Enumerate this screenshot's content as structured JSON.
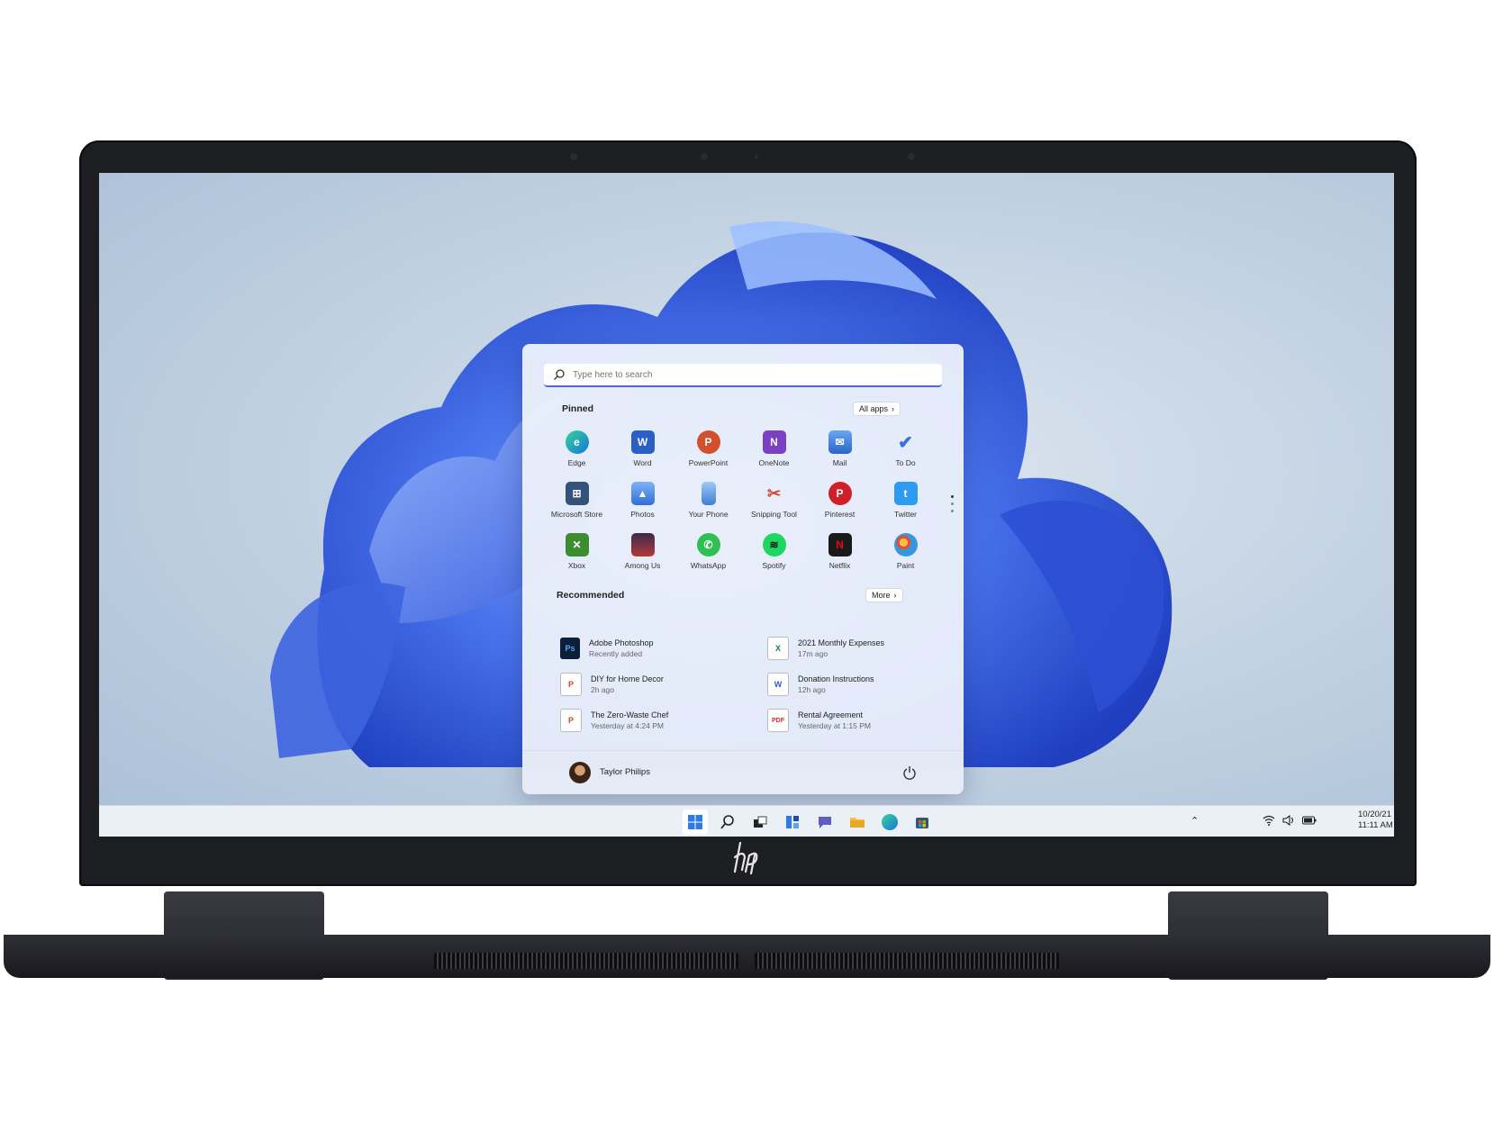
{
  "search": {
    "placeholder": "Type here to search"
  },
  "pinned": {
    "title": "Pinned",
    "all_apps": "All apps",
    "apps": [
      {
        "label": "Edge",
        "icon": "edge-icon"
      },
      {
        "label": "Word",
        "icon": "word-icon"
      },
      {
        "label": "PowerPoint",
        "icon": "powerpoint-icon"
      },
      {
        "label": "OneNote",
        "icon": "onenote-icon"
      },
      {
        "label": "Mail",
        "icon": "mail-icon"
      },
      {
        "label": "To Do",
        "icon": "todo-icon"
      },
      {
        "label": "Microsoft Store",
        "icon": "store-icon"
      },
      {
        "label": "Photos",
        "icon": "photos-icon"
      },
      {
        "label": "Your Phone",
        "icon": "phone-icon"
      },
      {
        "label": "Snipping Tool",
        "icon": "snipping-tool-icon"
      },
      {
        "label": "Pinterest",
        "icon": "pinterest-icon"
      },
      {
        "label": "Twitter",
        "icon": "twitter-icon"
      },
      {
        "label": "Xbox",
        "icon": "xbox-icon"
      },
      {
        "label": "Among Us",
        "icon": "among-us-icon"
      },
      {
        "label": "WhatsApp",
        "icon": "whatsapp-icon"
      },
      {
        "label": "Spotify",
        "icon": "spotify-icon"
      },
      {
        "label": "Netflix",
        "icon": "netflix-icon"
      },
      {
        "label": "Paint",
        "icon": "paint-icon"
      }
    ]
  },
  "recommended": {
    "title": "Recommended",
    "more": "More",
    "items": [
      {
        "name": "Adobe Photoshop",
        "sub": "Recently added",
        "icon": "photoshop-icon"
      },
      {
        "name": "2021 Monthly Expenses",
        "sub": "17m ago",
        "icon": "excel-file-icon"
      },
      {
        "name": "DIY for Home Decor",
        "sub": "2h ago",
        "icon": "powerpoint-file-icon"
      },
      {
        "name": "Donation Instructions",
        "sub": "12h ago",
        "icon": "word-file-icon"
      },
      {
        "name": "The Zero-Waste Chef",
        "sub": "Yesterday at 4:24 PM",
        "icon": "powerpoint-file-icon"
      },
      {
        "name": "Rental Agreement",
        "sub": "Yesterday at 1:15 PM",
        "icon": "pdf-file-icon"
      }
    ]
  },
  "user": {
    "name": "Taylor Philips"
  },
  "clock": {
    "date": "10/20/21",
    "time": "11:11 AM"
  },
  "colors": {
    "accent": "#4f6bd8",
    "bloom": "#3f63e6"
  }
}
